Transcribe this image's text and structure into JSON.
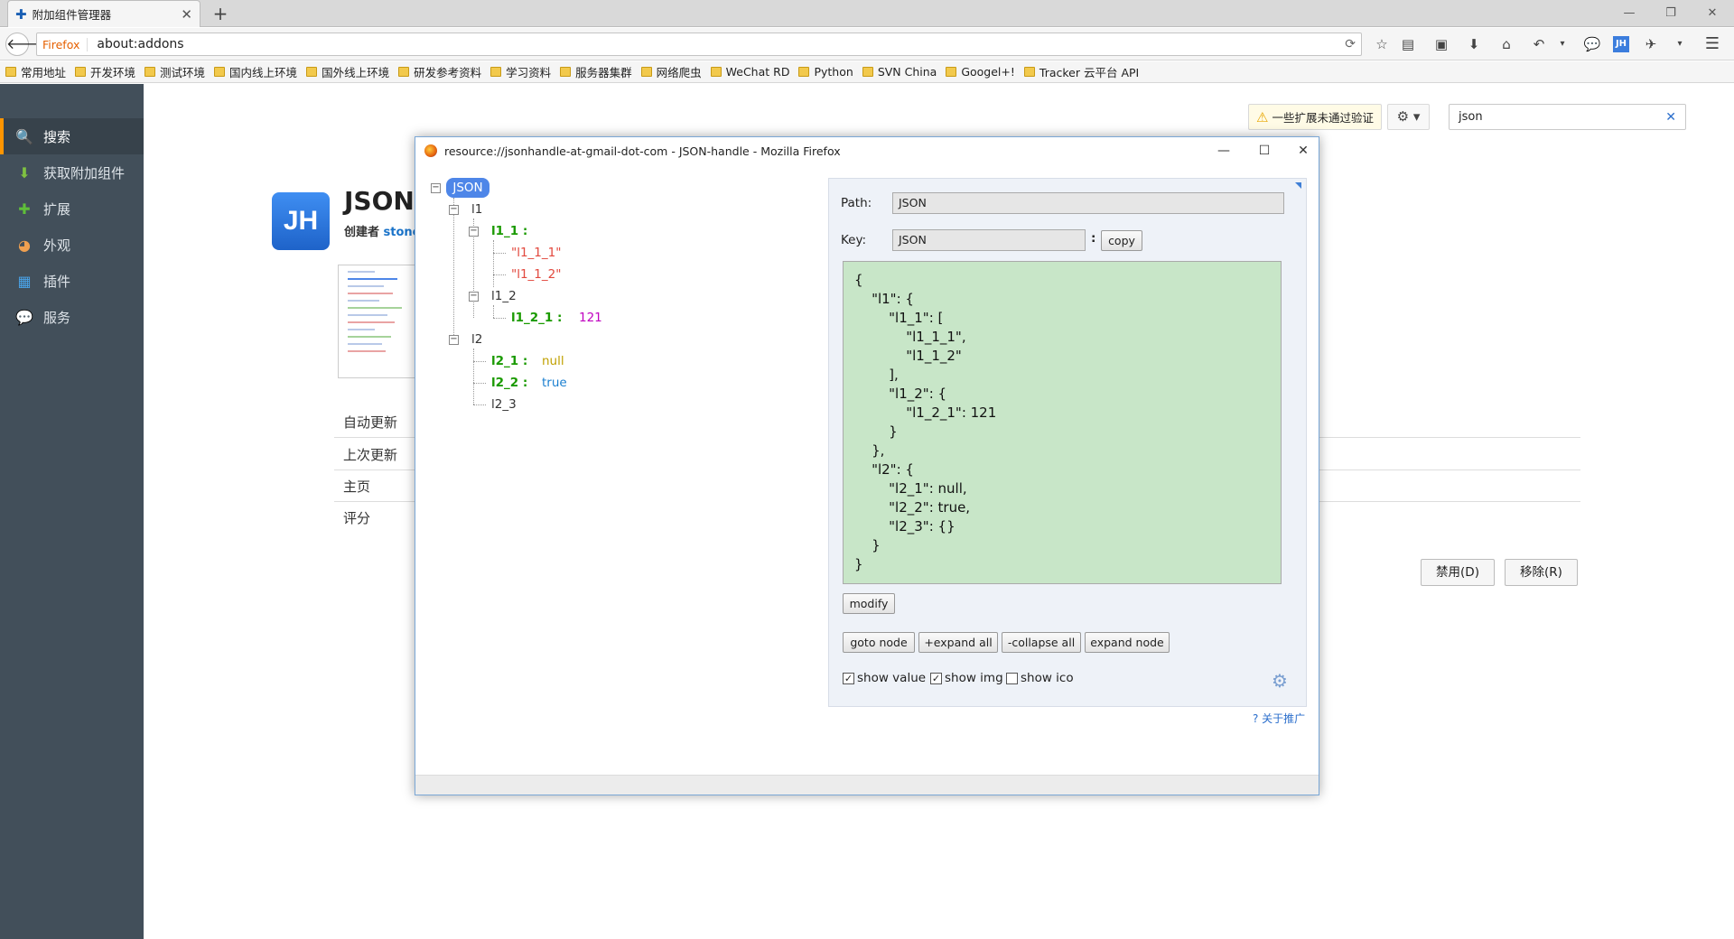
{
  "tab": {
    "title": "附加组件管理器"
  },
  "navbar": {
    "firefox_label": "Firefox",
    "url": "about:addons"
  },
  "bookmarks": [
    "常用地址",
    "开发环境",
    "测试环境",
    "国内线上环境",
    "国外线上环境",
    "研发参考资料",
    "学习资料",
    "服务器集群",
    "网络爬虫",
    "WeChat RD",
    "Python",
    "SVN China",
    "Googel+!",
    "Tracker 云平台 API"
  ],
  "sidebar": {
    "items": [
      {
        "label": "搜索",
        "icon": "search-icon",
        "active": true
      },
      {
        "label": "获取附加组件",
        "icon": "download-addons-icon"
      },
      {
        "label": "扩展",
        "icon": "puzzle-icon"
      },
      {
        "label": "外观",
        "icon": "palette-icon"
      },
      {
        "label": "插件",
        "icon": "plugin-icon"
      },
      {
        "label": "服务",
        "icon": "chat-bubble-icon"
      }
    ]
  },
  "addon": {
    "logo_text": "JH",
    "name": "JSON-",
    "author_prefix": "创建者",
    "author": "stone",
    "details": [
      "自动更新",
      "上次更新",
      "主页",
      "评分"
    ]
  },
  "toolbar": {
    "warning": "一些扩展未通过验证",
    "search_value": "json",
    "disable_label": "禁用(D)",
    "remove_label": "移除(R)"
  },
  "popup": {
    "title": "resource://jsonhandle-at-gmail-dot-com - JSON-handle - Mozilla Firefox",
    "tree": {
      "root": "JSON",
      "l1": "l1",
      "l1_1": "l1_1 :",
      "l1_1_1": "\"l1_1_1\"",
      "l1_1_2": "\"l1_1_2\"",
      "l1_2": "l1_2",
      "l1_2_1": "l1_2_1 :",
      "l1_2_1_val": "121",
      "l2": "l2",
      "l2_1": "l2_1 :",
      "l2_1_val": "null",
      "l2_2": "l2_2 :",
      "l2_2_val": "true",
      "l2_3": "l2_3"
    },
    "panel": {
      "path_label": "Path:",
      "path_value": "JSON",
      "key_label": "Key:",
      "key_value": "JSON",
      "colon": ":",
      "copy_label": "copy",
      "json_text": "{\n    \"l1\": {\n        \"l1_1\": [\n            \"l1_1_1\",\n            \"l1_1_2\"\n        ],\n        \"l1_2\": {\n            \"l1_2_1\": 121\n        }\n    },\n    \"l2\": {\n        \"l2_1\": null,\n        \"l2_2\": true,\n        \"l2_3\": {}\n    }\n}",
      "modify_label": "modify",
      "goto_label": "goto node",
      "expand_all_label": "+expand all",
      "collapse_all_label": "-collapse all",
      "expand_node_label": "expand node",
      "show_value": "show value",
      "show_img": "show img",
      "show_ico": "show ico"
    },
    "about_link": "? 关于推广"
  }
}
